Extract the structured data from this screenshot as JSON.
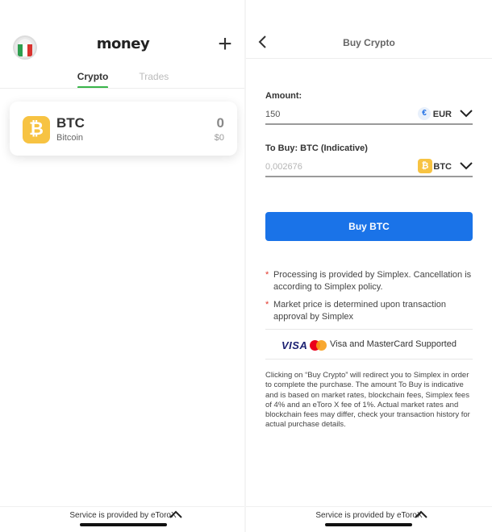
{
  "left": {
    "app_logo": "money",
    "tabs": [
      {
        "label": "Crypto",
        "active": true
      },
      {
        "label": "Trades",
        "active": false
      }
    ],
    "asset": {
      "symbol": "BTC",
      "name": "Bitcoin",
      "amount": "0",
      "fiat": "$0",
      "icon": "bitcoin-icon"
    },
    "footer": "Service is provided by eToroX"
  },
  "right": {
    "title": "Buy Crypto",
    "amount": {
      "label": "Amount:",
      "value": "150",
      "currency": "EUR",
      "currency_symbol": "€"
    },
    "to_buy": {
      "label": "To Buy: BTC (Indicative)",
      "placeholder": "0,002676",
      "currency": "BTC"
    },
    "buy_button": "Buy BTC",
    "notes": [
      "Processing is provided by Simplex. Cancellation is according to Simplex policy.",
      "Market price is determined upon transaction approval by Simplex"
    ],
    "payment": {
      "visa": "VISA",
      "text": "Visa and MasterCard Supported"
    },
    "disclaimer": "Clicking on “Buy Crypto” will redirect you to Simplex in order to complete the purchase. The amount To Buy is indicative and is based on market rates, blockchain fees, Simplex fees of 4% and an eToro X fee of 1%. Actual market rates and blockchain fees may differ, check your transaction history for actual purchase details.",
    "footer": "Service is provided by eToroX"
  },
  "colors": {
    "accent_blue": "#1a73e8",
    "tab_green": "#39b54a",
    "btc_yellow": "#f7c342",
    "asterisk_red": "#e2372b"
  }
}
